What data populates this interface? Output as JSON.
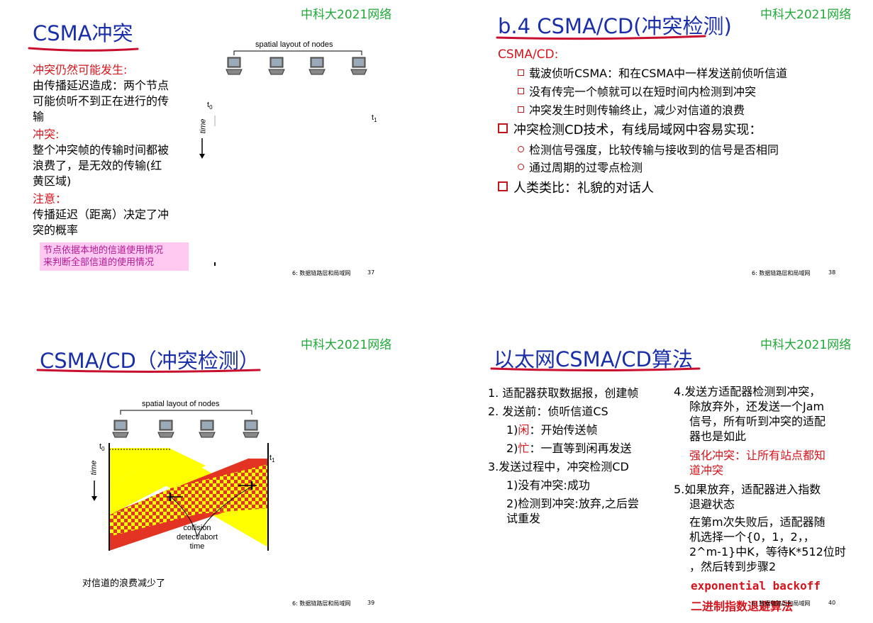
{
  "slides": {
    "s1": {
      "brand": "中科大2021网络",
      "title": "CSMA冲突",
      "diagram": {
        "caption": "spatial layout of nodes",
        "t0": "t",
        "t0_sub": "0",
        "t1": "t",
        "t1_sub": "1",
        "time": "time"
      },
      "b1_head": "冲突仍然可能发生:",
      "b1_body": [
        "由传播延迟造成：两个节点",
        "可能侦听不到正在进行的传",
        "输"
      ],
      "b2_head": "冲突:",
      "b2_body": [
        "整个冲突帧的传输时间都被",
        "浪费了，是无效的传输(红",
        "黄区域)"
      ],
      "b3_head": "注意：",
      "b3_body": [
        "传播延迟（距离）决定了冲",
        "突的概率"
      ],
      "note": [
        "节点依据本地的信道使用情况",
        "来判断全部信道的使用情况"
      ],
      "footer": "6: 数据链路层和局域网",
      "page": "37"
    },
    "s2": {
      "brand": "中科大2021网络",
      "title": "b.4 CSMA/CD(冲突检测)",
      "head": "CSMA/CD:",
      "sub1": "载波侦听CSMA：和在CSMA中一样发送前侦听信道",
      "sub2": "没有传完一个帧就可以在短时间内检测到冲突",
      "sub3": "冲突发生时则传输终止，减少对信道的浪费",
      "bul1": "冲突检测CD技术，有线局域网中容易实现：",
      "c1": "检测信号强度，比较传输与接收到的信号是否相同",
      "c2": "通过周期的过零点检测",
      "bul2": "人类类比：礼貌的对话人",
      "footer": "6: 数据链路层和局域网",
      "page": "38"
    },
    "s3": {
      "brand": "中科大2021网络",
      "title": "CSMA/CD（冲突检测）",
      "diagram": {
        "caption": "spatial layout of nodes",
        "t0": "t",
        "t0_sub": "0",
        "t1": "t",
        "t1_sub": "1",
        "time": "time",
        "collision": [
          "collision",
          "detect/abort",
          "time"
        ]
      },
      "note": "对信道的浪费减少了",
      "footer": "6: 数据链路层和局域网",
      "page": "39"
    },
    "s4": {
      "brand": "中科大2021网络",
      "title": "以太网CSMA/CD算法",
      "l1": "1. 适配器获取数据报，创建帧",
      "l2": "2. 发送前：侦听信道CS",
      "l2a_pre": "1)",
      "l2a_red": "闲",
      "l2a_post": "：开始传送帧",
      "l2b_pre": "2)",
      "l2b_red": "忙",
      "l2b_post": "：一直等到闲再发送",
      "l3": "3.发送过程中，冲突检测CD",
      "l3a": "1)没有冲突:成功",
      "l3b": [
        "2)检测到冲突:放弃,之后尝",
        "试重发"
      ],
      "r4": [
        "4.发送方适配器检测到冲突，",
        "除放弃外，还发送一个Jam",
        "信号，所有听到冲突的适配",
        "器也是如此"
      ],
      "r4red": [
        "强化冲突：让所有站点都知",
        "道冲突"
      ],
      "r5": [
        "5.如果放弃，适配器进入指数",
        "退避状态"
      ],
      "r5b": [
        "在第m次失败后，适配器随",
        "机选择一个{0，1，2，，",
        "2^m-1}中K，等待K*512位时",
        "，然后转到步骤2"
      ],
      "exp": "exponential backoff",
      "bin": "二进制指数退避算法",
      "footer": "6: 数据链路层和局域网",
      "page": "40"
    }
  },
  "colors": {
    "title": "#1a2ea8",
    "brand": "#22a83a",
    "red": "#d4141d",
    "underline": "#c8102e",
    "note_bg": "#ffc9f2",
    "yellow": "#ffff00"
  },
  "icons": [
    "computer-icon"
  ]
}
